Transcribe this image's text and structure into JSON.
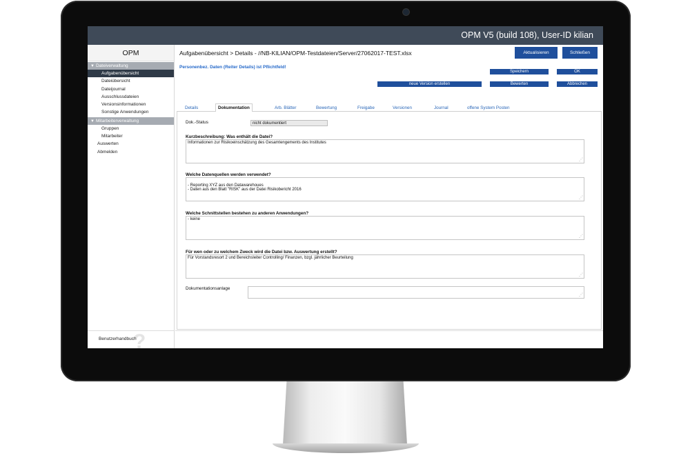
{
  "window": {
    "title": "OPM V5 (build 108), User-ID kilian"
  },
  "sidebar": {
    "brand": "OPM",
    "groups": [
      {
        "label": "Dateiverwaltung",
        "items": [
          "Aufgabenübersicht",
          "Dateiübersicht",
          "Dateijournal",
          "Ausschlussdateien",
          "Versionsinformationen",
          "Sonstige Anwendungen"
        ]
      },
      {
        "label": "Mitarbeiterverwaltung",
        "items": [
          "Gruppen",
          "Mitarbeiter"
        ]
      }
    ],
    "top_items": [
      "Auswerten",
      "Abmelden"
    ],
    "active_item": "Aufgabenübersicht",
    "footer_label": "Benutzerhandbuch",
    "help_icon": "question-mark-icon"
  },
  "header": {
    "breadcrumb": "Aufgabenübersicht > Details - //NB-KILIAN/OPM-Testdateien/Server/27062017-TEST.xlsx",
    "refresh_label": "Aktualisieren",
    "close_label": "Schließen"
  },
  "notice": "Personenbez. Daten (Reiter Details) ist Pflichtfeld!",
  "actions": {
    "save": "Speichern",
    "ok": "OK",
    "new_version": "neue Version erstellen",
    "evaluate": "Bewerten",
    "cancel": "Abbrechen"
  },
  "tabs": [
    "Details",
    "Dokumentation",
    "Arb. Blätter",
    "Bewertung",
    "Freigabe",
    "Versionen",
    "Journal",
    "offene System Posten"
  ],
  "active_tab": "Dokumentation",
  "form": {
    "status_label": "Dok.-Status",
    "status_value": "nicht dokumentiert",
    "q1_label": "Kurzbeschreibung: Was enthält die Datei?",
    "q1_value": "Informationen zur Risikoeinschätzung des Gesamtengements des Institutes",
    "q2_label": "Welche Datenquellen werden verwendet?",
    "q2_value": "- Reporting XYZ aus den Datawarehoues\n- Daten aus den Blatt \"RISK\" aus der Datei Risikobericht 2016",
    "q3_label": "Welche Schnittstellen bestehen zu anderen Anwendungen?",
    "q3_value": "- keine",
    "q4_label": "Für wen oder zu welchem Zweck wird die Datei bzw. Auswertung erstellt?",
    "q4_value": "Für Vorstandsresort 2 und Bereichsleiter Controlling/ Finanzen, bzgl. jährlicher Beurteilung",
    "attachment_label": "Dokumentationsanlage",
    "attachment_value": ""
  },
  "colors": {
    "topbar": "#3f4a58",
    "button": "#1f4f9c",
    "active_nav": "#2f3a47",
    "notice": "#2468c9",
    "tab_link": "#2a67b8"
  }
}
